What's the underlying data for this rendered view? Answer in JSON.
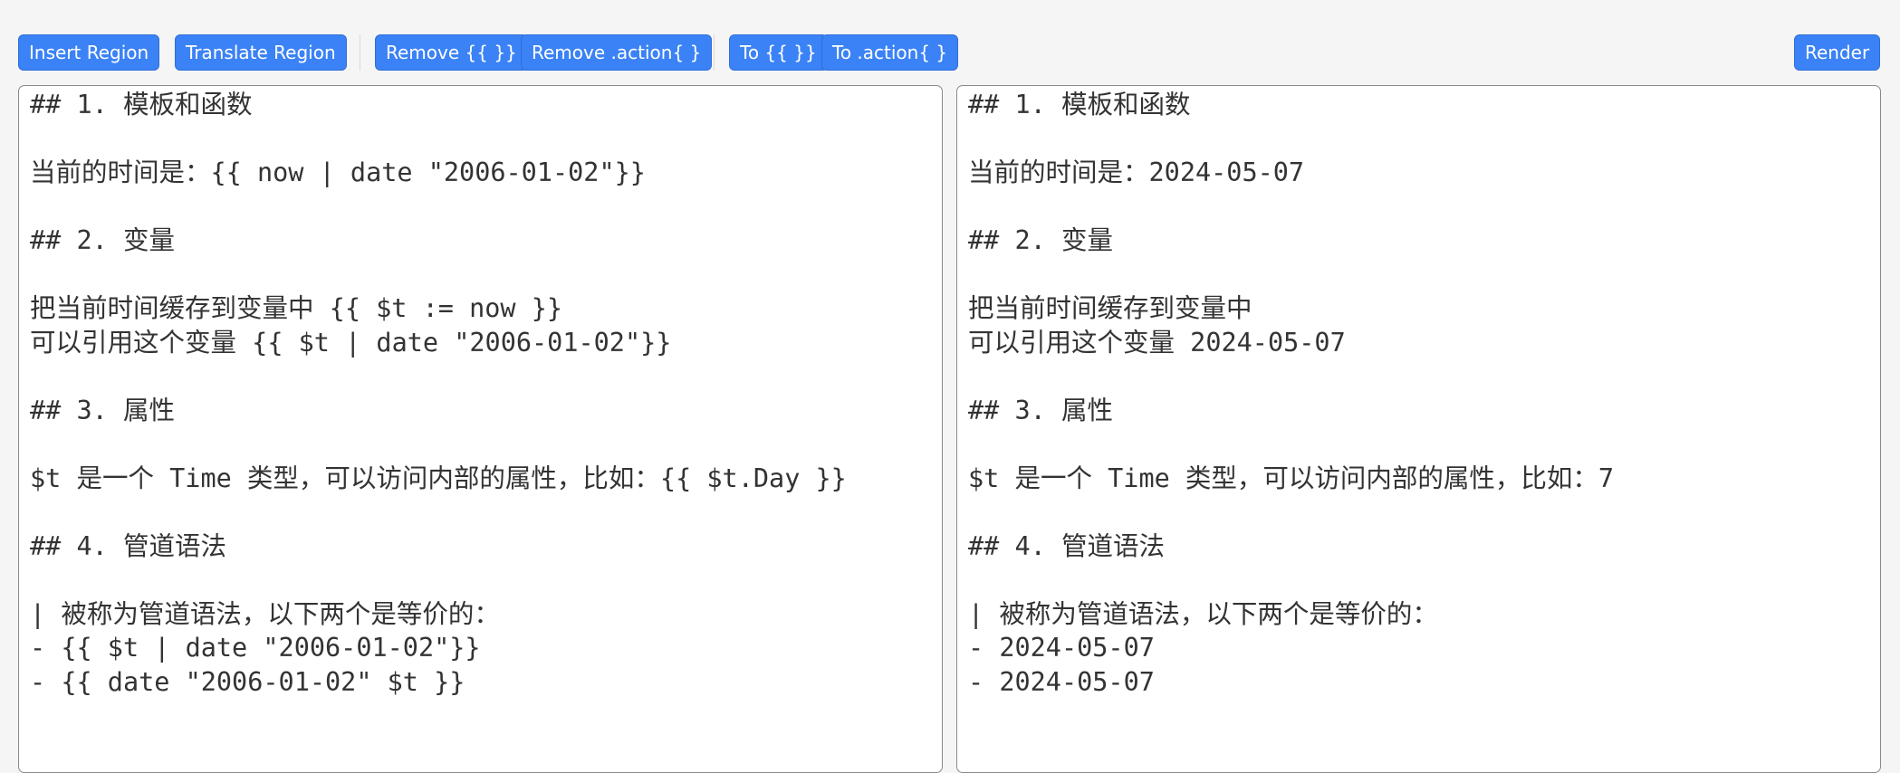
{
  "toolbar": {
    "insert_region": "Insert Region",
    "translate_region": "Translate Region",
    "remove_braces": "Remove {{ }}",
    "remove_action": "Remove .action{ }",
    "to_braces": "To {{ }}",
    "to_action": "To .action{ }",
    "render": "Render"
  },
  "colors": {
    "button_bg": "#3b82f6",
    "button_text": "#ffffff",
    "page_bg": "#f5f5f5",
    "editor_bg": "#ffffff",
    "editor_text": "#333333"
  },
  "source_editor": {
    "content": "## 1. 模板和函数\n\n当前的时间是：{{ now | date \"2006-01-02\"}}\n\n## 2. 变量\n\n把当前时间缓存到变量中 {{ $t := now }}\n可以引用这个变量 {{ $t | date \"2006-01-02\"}}\n\n## 3. 属性\n\n$t 是一个 Time 类型，可以访问内部的属性，比如：{{ $t.Day }}\n\n## 4. 管道语法\n\n| 被称为管道语法，以下两个是等价的：\n- {{ $t | date \"2006-01-02\"}}\n- {{ date \"2006-01-02\" $t }}"
  },
  "output_editor": {
    "content": "## 1. 模板和函数\n\n当前的时间是：2024-05-07\n\n## 2. 变量\n\n把当前时间缓存到变量中\n可以引用这个变量 2024-05-07\n\n## 3. 属性\n\n$t 是一个 Time 类型，可以访问内部的属性，比如：7\n\n## 4. 管道语法\n\n| 被称为管道语法，以下两个是等价的：\n- 2024-05-07\n- 2024-05-07"
  }
}
